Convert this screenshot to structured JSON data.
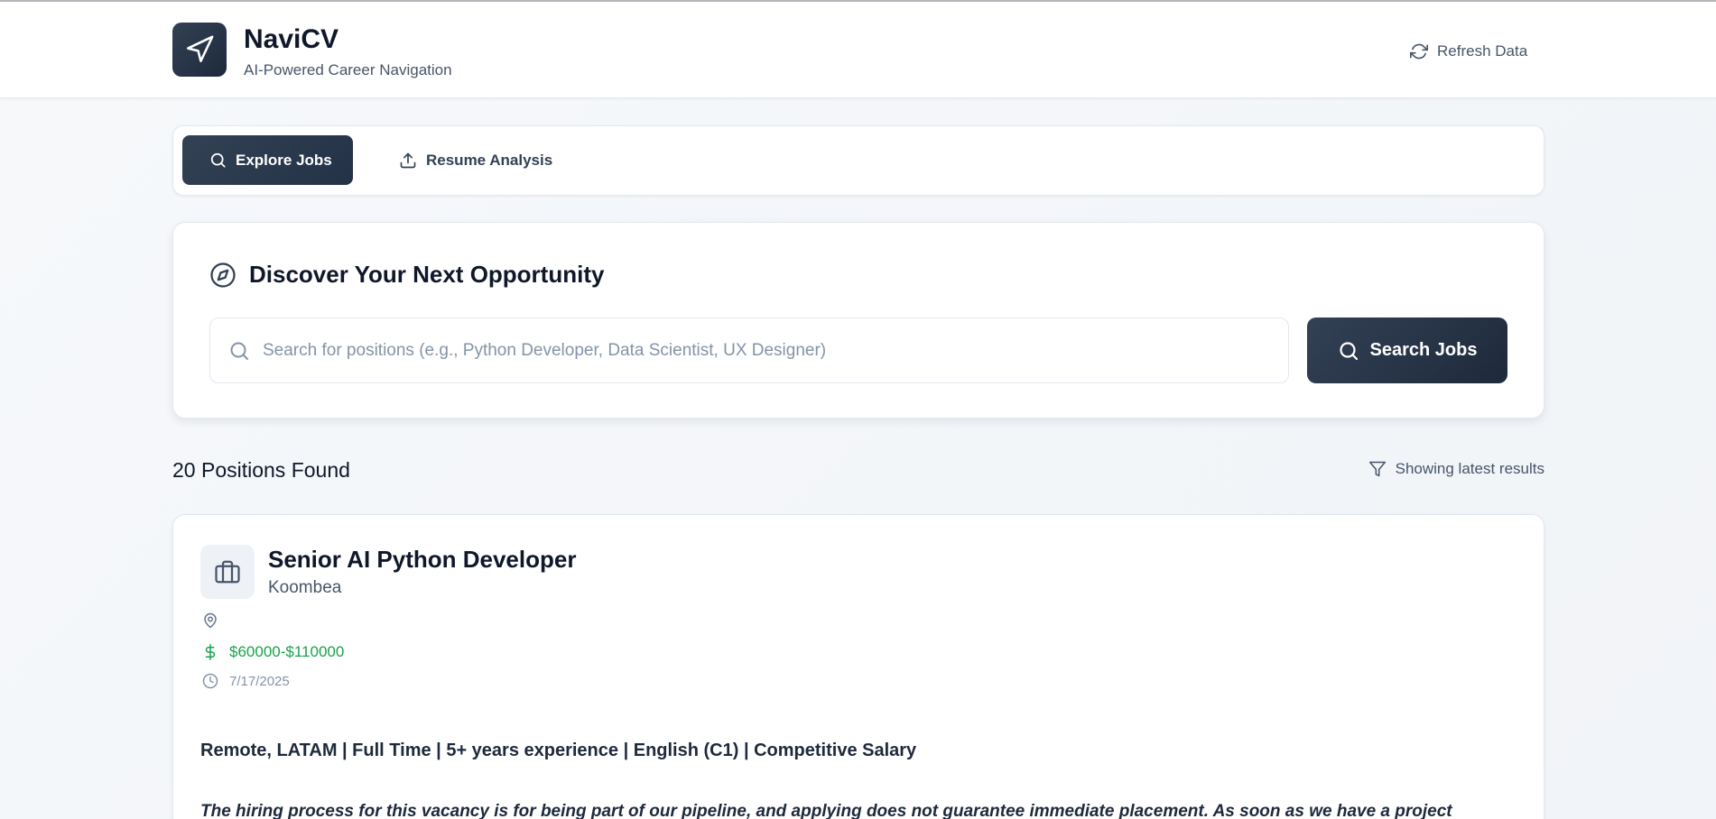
{
  "app": {
    "title": "NaviCV",
    "subtitle": "AI-Powered Career Navigation",
    "logo_icon": "paper-plane-icon",
    "refresh_label": "Refresh Data"
  },
  "tabs": [
    {
      "label": "Explore Jobs",
      "icon": "search-icon",
      "active": true
    },
    {
      "label": "Resume Analysis",
      "icon": "upload-icon",
      "active": false
    }
  ],
  "search": {
    "heading": "Discover Your Next Opportunity",
    "heading_icon": "compass-icon",
    "placeholder": "Search for positions (e.g., Python Developer, Data Scientist, UX Designer)",
    "value": "",
    "button_label": "Search Jobs"
  },
  "results": {
    "count_label": "20 Positions Found",
    "filter_label": "Showing latest results"
  },
  "jobs": [
    {
      "title": "Senior AI Python Developer",
      "company": "Koombea",
      "location": "",
      "salary": "$60000-$110000",
      "date": "7/17/2025",
      "summary": "Remote, LATAM | Full Time | 5+ years experience | English (C1) | Competitive Salary",
      "description": "The hiring process for this vacancy is for being part of our pipeline, and applying does not guarantee immediate placement. As soon as we have a project"
    }
  ],
  "colors": {
    "primary": "#334155",
    "primary_dark": "#1e293b",
    "salary": "#16a34a",
    "muted": "#8593a7"
  }
}
